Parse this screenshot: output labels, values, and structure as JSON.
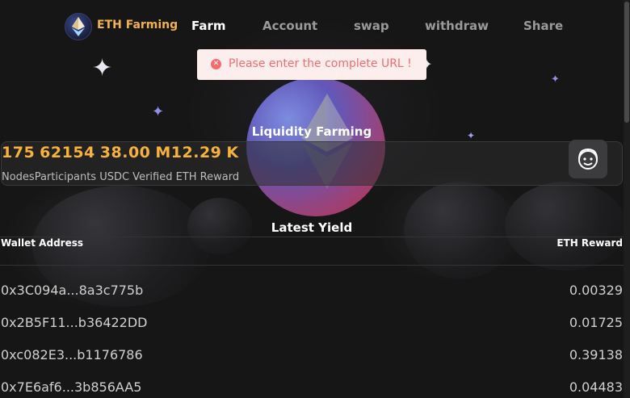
{
  "header": {
    "brand": "ETH Farming",
    "nav": [
      "Farm",
      "Account",
      "swap",
      "withdraw",
      "Share"
    ],
    "active": "Farm"
  },
  "toast": {
    "message": "Please enter the complete URL !",
    "icon": "error-circle-icon"
  },
  "hero": {
    "title": "Liquidity Farming"
  },
  "stats": {
    "values": [
      "175",
      "62154",
      "38.00",
      "M12.29",
      "K"
    ],
    "labels": "NodesParticipants USDC Verified ETH Reward",
    "support_icon": "customer-support-icon"
  },
  "yield": {
    "title": "Latest Yield",
    "headers": [
      "Wallet Address",
      "ETH Reward"
    ],
    "rows": [
      {
        "address": "0x3C094a...8a3c775b",
        "reward": "0.00329"
      },
      {
        "address": "0x2B5F11...b36422DD",
        "reward": "0.01725"
      },
      {
        "address": "0xc082E3...b1176786",
        "reward": "0.39138"
      },
      {
        "address": "0x7E6af6...3b856AA5",
        "reward": "0.04483"
      }
    ]
  },
  "colors": {
    "accent": "#f7b23b",
    "error": "#f56c6c",
    "background": "#171717"
  }
}
